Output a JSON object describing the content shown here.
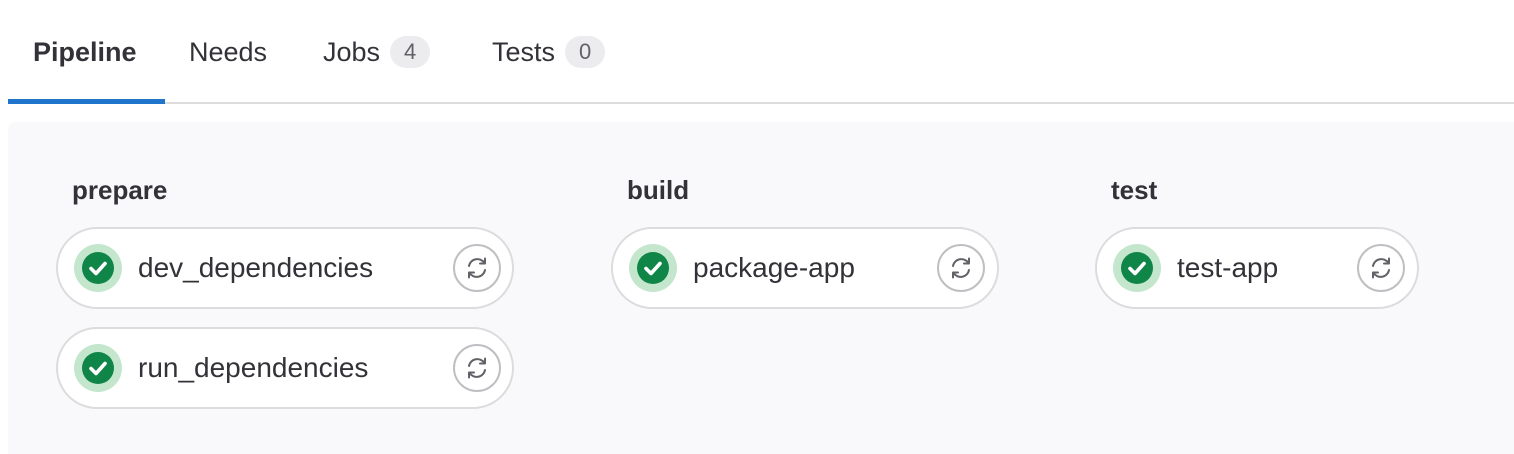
{
  "tabs": [
    {
      "label": "Pipeline",
      "active": true
    },
    {
      "label": "Needs"
    },
    {
      "label": "Jobs",
      "count": "4"
    },
    {
      "label": "Tests",
      "count": "0"
    }
  ],
  "stages": [
    {
      "name": "prepare",
      "jobs": [
        {
          "name": "dev_dependencies",
          "status": "success",
          "status_icon": "check-circle-icon",
          "action_icon": "retry-icon"
        },
        {
          "name": "run_dependencies",
          "status": "success",
          "status_icon": "check-circle-icon",
          "action_icon": "retry-icon"
        }
      ]
    },
    {
      "name": "build",
      "jobs": [
        {
          "name": "package-app",
          "status": "success",
          "status_icon": "check-circle-icon",
          "action_icon": "retry-icon"
        }
      ]
    },
    {
      "name": "test",
      "jobs": [
        {
          "name": "test-app",
          "status": "success",
          "status_icon": "check-circle-icon",
          "action_icon": "retry-icon"
        }
      ]
    }
  ],
  "colors": {
    "active_tab_underline": "#1f75cb",
    "success": "#108548",
    "success_halo": "#c3e6cd",
    "graph_background": "#f9f9fb"
  }
}
